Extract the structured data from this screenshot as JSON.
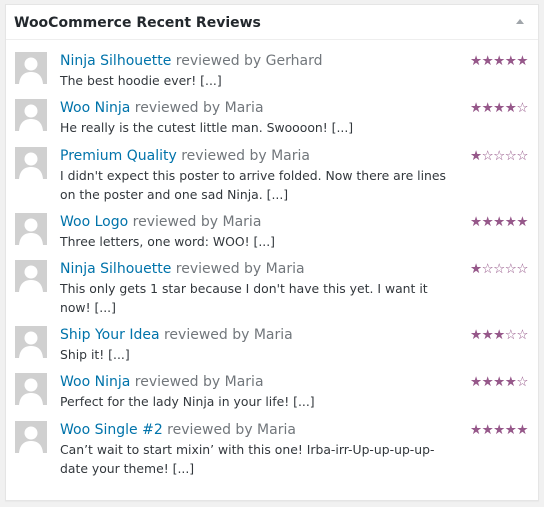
{
  "widget": {
    "title": "WooCommerce Recent Reviews"
  },
  "colors": {
    "star": "#96588a",
    "link": "#0073aa"
  },
  "reviews": [
    {
      "product": "Ninja Silhouette",
      "reviewer_text": " reviewed by Gerhard",
      "text": "The best hoodie ever! [...]",
      "rating": 5
    },
    {
      "product": "Woo Ninja",
      "reviewer_text": " reviewed by Maria",
      "text": "He really is the cutest little man. Swoooon! [...]",
      "rating": 4
    },
    {
      "product": "Premium Quality",
      "reviewer_text": " reviewed by Maria",
      "text": "I didn't expect this poster to arrive folded. Now there are lines on the poster and one sad Ninja. [...]",
      "rating": 1
    },
    {
      "product": "Woo Logo",
      "reviewer_text": " reviewed by Maria",
      "text": "Three letters, one word: WOO! [...]",
      "rating": 5
    },
    {
      "product": "Ninja Silhouette",
      "reviewer_text": " reviewed by Maria",
      "text": "This only gets 1 star because I don't have this yet. I want it now! [...]",
      "rating": 1
    },
    {
      "product": "Ship Your Idea",
      "reviewer_text": " reviewed by Maria",
      "text": "Ship it! [...]",
      "rating": 3
    },
    {
      "product": "Woo Ninja",
      "reviewer_text": " reviewed by Maria",
      "text": "Perfect for the lady Ninja in your life! [...]",
      "rating": 4
    },
    {
      "product": "Woo Single #2",
      "reviewer_text": " reviewed by Maria",
      "text": "Can’t wait to start mixin’ with this one! Irba-irr-Up-up-up-up-date your theme! [...]",
      "rating": 5
    }
  ]
}
